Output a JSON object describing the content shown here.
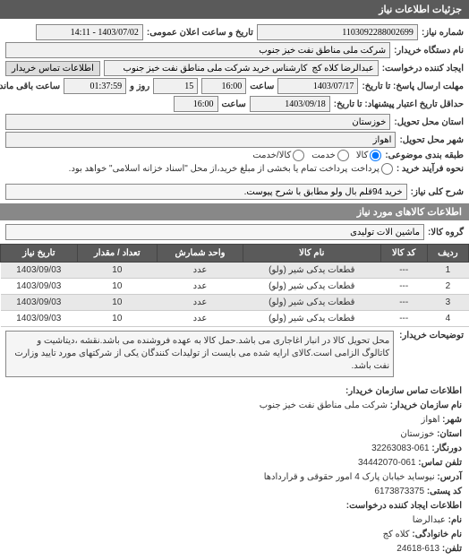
{
  "header": {
    "title": "جزئیات اطلاعات نیاز"
  },
  "form": {
    "request_no_label": "شماره نیاز:",
    "request_no": "1103092288002699",
    "public_date_label": "تاریخ و ساعت اعلان عمومی:",
    "public_date": "1403/07/02 - 14:11",
    "buyer_label": "نام دستگاه خریدار:",
    "buyer": "شرکت ملی مناطق نفت خیز جنوب",
    "requester_label": "ایجاد کننده درخواست:",
    "requester": "عبدالرضا کلاه کج  کارشناس خرید شرکت ملی مناطق نفت خیز جنوب",
    "contact_btn": "اطلاعات تماس خریدار",
    "deadline_label": "مهلت ارسال پاسخ: تا تاریخ:",
    "deadline_date": "1403/07/17",
    "time_label": "ساعت",
    "deadline_time": "16:00",
    "remain_label1": "روز و",
    "remain_days": "15",
    "remain_label2": "ساعت باقی مانده",
    "remain_time": "01:37:59",
    "validity_label": "حداقل تاریخ اعتبار پیشنهاد: تا تاریخ:",
    "validity_date": "1403/09/18",
    "validity_time": "16:00",
    "province_label": "استان محل تحویل:",
    "province": "خوزستان",
    "city_label": "شهر محل تحویل:",
    "city": "اهواز",
    "subject_type_label": "طبقه بندی موضوعی:",
    "radio_goods": "کالا",
    "radio_service": "خدمت",
    "radio_both": "کالا/خدمت",
    "payment_label": "نحوه فرآیند خرید :",
    "radio_direct": "پرداخت",
    "payment_note": "پرداخت تمام یا بخشی از مبلغ خرید،از محل \"اسناد خزانه اسلامی\" خواهد بود."
  },
  "need_title": {
    "label": "شرح کلی نیاز:",
    "value": "خرید 94قلم بال ولو مطابق با شرح پیوست."
  },
  "goods_header": "اطلاعات کالاهای مورد نیاز",
  "group_label": "گروه کالا:",
  "group_value": "ماشین آلات تولیدی",
  "table": {
    "headers": [
      "ردیف",
      "کد کالا",
      "نام کالا",
      "واحد شمارش",
      "تعداد / مقدار",
      "تاریخ نیاز"
    ],
    "rows": [
      [
        "1",
        "---",
        "قطعات یدکی شیر (ولو)",
        "عدد",
        "10",
        "1403/09/03"
      ],
      [
        "2",
        "---",
        "قطعات یدکی شیر (ولو)",
        "عدد",
        "10",
        "1403/09/03"
      ],
      [
        "3",
        "---",
        "قطعات یدکی شیر (ولو)",
        "عدد",
        "10",
        "1403/09/03"
      ],
      [
        "4",
        "---",
        "قطعات یدکی شیر (ولو)",
        "عدد",
        "10",
        "1403/09/03"
      ]
    ]
  },
  "description": {
    "label": "توضیحات خریدار:",
    "text": "محل تحویل کالا در انبار اغاجاری می باشد.حمل کالا به عهده فروشنده می باشد.نقشه ،دیتاشیت و کاتالوگ الزامی است.کالای ارایه شده می بایست از تولیدات کنندگان یکی از شرکتهای مورد تایید وزارت نفت باشد."
  },
  "contact": {
    "header": "اطلاعات تماس سازمان خریدار:",
    "org_label": "نام سازمان خریدار:",
    "org": "شرکت ملی مناطق نفت خیز جنوب",
    "city_label": "شهر:",
    "city": "اهواز",
    "province_label": "استان:",
    "province": "خوزستان",
    "fax_label": "دورنگار:",
    "fax": "061-32263083",
    "phone_label": "تلفن تماس:",
    "phone": "061-34442070",
    "address_label": "آدرس:",
    "address": "نیوساید خیابان پارک 4 امور حقوقی و قراردادها",
    "postal_label": "کد پستی:",
    "postal": "6173873375",
    "creator_header": "اطلاعات ایجاد کننده درخواست:",
    "name_label": "نام:",
    "name": "عبدالرضا",
    "family_label": "نام خانوادگی:",
    "family": "کلاه کج",
    "tel_label": "تلفن:",
    "tel": "613-24618"
  }
}
